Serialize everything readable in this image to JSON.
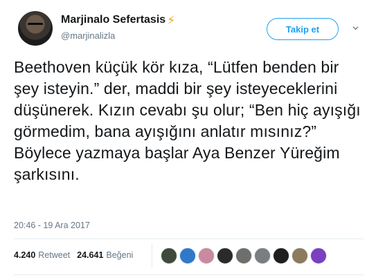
{
  "tweet": {
    "author_name": "Marjinalo Sefertasis",
    "author_badge": "⚡",
    "handle": "@marjinalizla",
    "follow_label": "Takip et",
    "text": "Beethoven küçük kör kıza, “Lütfen benden bir şey isteyin.” der, maddi bir şey isteyeceklerini düşünerek. Kızın cevabı şu olur; “Ben hiç ayışığı görmedim, bana ayışığını anlatır mısınız?” Böylece yazmaya başlar Aya Benzer Yüreğim şarkısını.",
    "timestamp": "20:46 - 19 Ara 2017",
    "retweets": {
      "count": "4.240",
      "label": "Retweet"
    },
    "likes": {
      "count": "24.641",
      "label": "Beğeni"
    }
  },
  "colors": {
    "accent": "#1da1f2",
    "muted": "#657786",
    "text": "#14171a",
    "border": "#e6ecf0",
    "bolt": "#f5a623"
  },
  "liker_avatars": [
    {
      "name": "liker-avatar-1",
      "color": "#3e4a3b"
    },
    {
      "name": "liker-avatar-2",
      "color": "#2f79c9"
    },
    {
      "name": "liker-avatar-3",
      "color": "#c98aa0"
    },
    {
      "name": "liker-avatar-4",
      "color": "#2a2a2a"
    },
    {
      "name": "liker-avatar-5",
      "color": "#6d6f6a"
    },
    {
      "name": "liker-avatar-6",
      "color": "#7a7e82"
    },
    {
      "name": "liker-avatar-7",
      "color": "#1f1f1f"
    },
    {
      "name": "liker-avatar-8",
      "color": "#8c7b5c"
    },
    {
      "name": "liker-avatar-9",
      "color": "#7b3fbf"
    }
  ]
}
